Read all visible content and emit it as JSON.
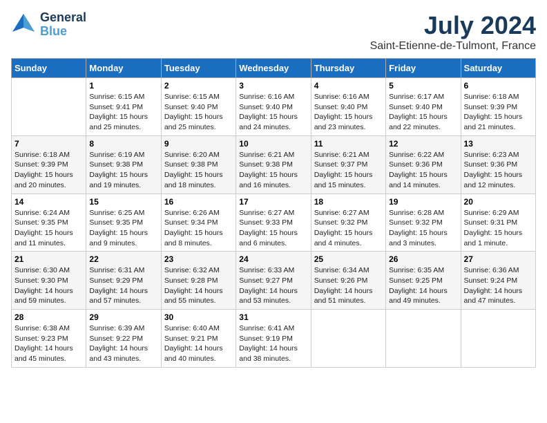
{
  "logo": {
    "line1": "General",
    "line2": "Blue"
  },
  "title": "July 2024",
  "subtitle": "Saint-Etienne-de-Tulmont, France",
  "days_of_week": [
    "Sunday",
    "Monday",
    "Tuesday",
    "Wednesday",
    "Thursday",
    "Friday",
    "Saturday"
  ],
  "weeks": [
    [
      {
        "day": "",
        "content": ""
      },
      {
        "day": "1",
        "content": "Sunrise: 6:15 AM\nSunset: 9:41 PM\nDaylight: 15 hours\nand 25 minutes."
      },
      {
        "day": "2",
        "content": "Sunrise: 6:15 AM\nSunset: 9:40 PM\nDaylight: 15 hours\nand 25 minutes."
      },
      {
        "day": "3",
        "content": "Sunrise: 6:16 AM\nSunset: 9:40 PM\nDaylight: 15 hours\nand 24 minutes."
      },
      {
        "day": "4",
        "content": "Sunrise: 6:16 AM\nSunset: 9:40 PM\nDaylight: 15 hours\nand 23 minutes."
      },
      {
        "day": "5",
        "content": "Sunrise: 6:17 AM\nSunset: 9:40 PM\nDaylight: 15 hours\nand 22 minutes."
      },
      {
        "day": "6",
        "content": "Sunrise: 6:18 AM\nSunset: 9:39 PM\nDaylight: 15 hours\nand 21 minutes."
      }
    ],
    [
      {
        "day": "7",
        "content": "Sunrise: 6:18 AM\nSunset: 9:39 PM\nDaylight: 15 hours\nand 20 minutes."
      },
      {
        "day": "8",
        "content": "Sunrise: 6:19 AM\nSunset: 9:38 PM\nDaylight: 15 hours\nand 19 minutes."
      },
      {
        "day": "9",
        "content": "Sunrise: 6:20 AM\nSunset: 9:38 PM\nDaylight: 15 hours\nand 18 minutes."
      },
      {
        "day": "10",
        "content": "Sunrise: 6:21 AM\nSunset: 9:38 PM\nDaylight: 15 hours\nand 16 minutes."
      },
      {
        "day": "11",
        "content": "Sunrise: 6:21 AM\nSunset: 9:37 PM\nDaylight: 15 hours\nand 15 minutes."
      },
      {
        "day": "12",
        "content": "Sunrise: 6:22 AM\nSunset: 9:36 PM\nDaylight: 15 hours\nand 14 minutes."
      },
      {
        "day": "13",
        "content": "Sunrise: 6:23 AM\nSunset: 9:36 PM\nDaylight: 15 hours\nand 12 minutes."
      }
    ],
    [
      {
        "day": "14",
        "content": "Sunrise: 6:24 AM\nSunset: 9:35 PM\nDaylight: 15 hours\nand 11 minutes."
      },
      {
        "day": "15",
        "content": "Sunrise: 6:25 AM\nSunset: 9:35 PM\nDaylight: 15 hours\nand 9 minutes."
      },
      {
        "day": "16",
        "content": "Sunrise: 6:26 AM\nSunset: 9:34 PM\nDaylight: 15 hours\nand 8 minutes."
      },
      {
        "day": "17",
        "content": "Sunrise: 6:27 AM\nSunset: 9:33 PM\nDaylight: 15 hours\nand 6 minutes."
      },
      {
        "day": "18",
        "content": "Sunrise: 6:27 AM\nSunset: 9:32 PM\nDaylight: 15 hours\nand 4 minutes."
      },
      {
        "day": "19",
        "content": "Sunrise: 6:28 AM\nSunset: 9:32 PM\nDaylight: 15 hours\nand 3 minutes."
      },
      {
        "day": "20",
        "content": "Sunrise: 6:29 AM\nSunset: 9:31 PM\nDaylight: 15 hours\nand 1 minute."
      }
    ],
    [
      {
        "day": "21",
        "content": "Sunrise: 6:30 AM\nSunset: 9:30 PM\nDaylight: 14 hours\nand 59 minutes."
      },
      {
        "day": "22",
        "content": "Sunrise: 6:31 AM\nSunset: 9:29 PM\nDaylight: 14 hours\nand 57 minutes."
      },
      {
        "day": "23",
        "content": "Sunrise: 6:32 AM\nSunset: 9:28 PM\nDaylight: 14 hours\nand 55 minutes."
      },
      {
        "day": "24",
        "content": "Sunrise: 6:33 AM\nSunset: 9:27 PM\nDaylight: 14 hours\nand 53 minutes."
      },
      {
        "day": "25",
        "content": "Sunrise: 6:34 AM\nSunset: 9:26 PM\nDaylight: 14 hours\nand 51 minutes."
      },
      {
        "day": "26",
        "content": "Sunrise: 6:35 AM\nSunset: 9:25 PM\nDaylight: 14 hours\nand 49 minutes."
      },
      {
        "day": "27",
        "content": "Sunrise: 6:36 AM\nSunset: 9:24 PM\nDaylight: 14 hours\nand 47 minutes."
      }
    ],
    [
      {
        "day": "28",
        "content": "Sunrise: 6:38 AM\nSunset: 9:23 PM\nDaylight: 14 hours\nand 45 minutes."
      },
      {
        "day": "29",
        "content": "Sunrise: 6:39 AM\nSunset: 9:22 PM\nDaylight: 14 hours\nand 43 minutes."
      },
      {
        "day": "30",
        "content": "Sunrise: 6:40 AM\nSunset: 9:21 PM\nDaylight: 14 hours\nand 40 minutes."
      },
      {
        "day": "31",
        "content": "Sunrise: 6:41 AM\nSunset: 9:19 PM\nDaylight: 14 hours\nand 38 minutes."
      },
      {
        "day": "",
        "content": ""
      },
      {
        "day": "",
        "content": ""
      },
      {
        "day": "",
        "content": ""
      }
    ]
  ]
}
